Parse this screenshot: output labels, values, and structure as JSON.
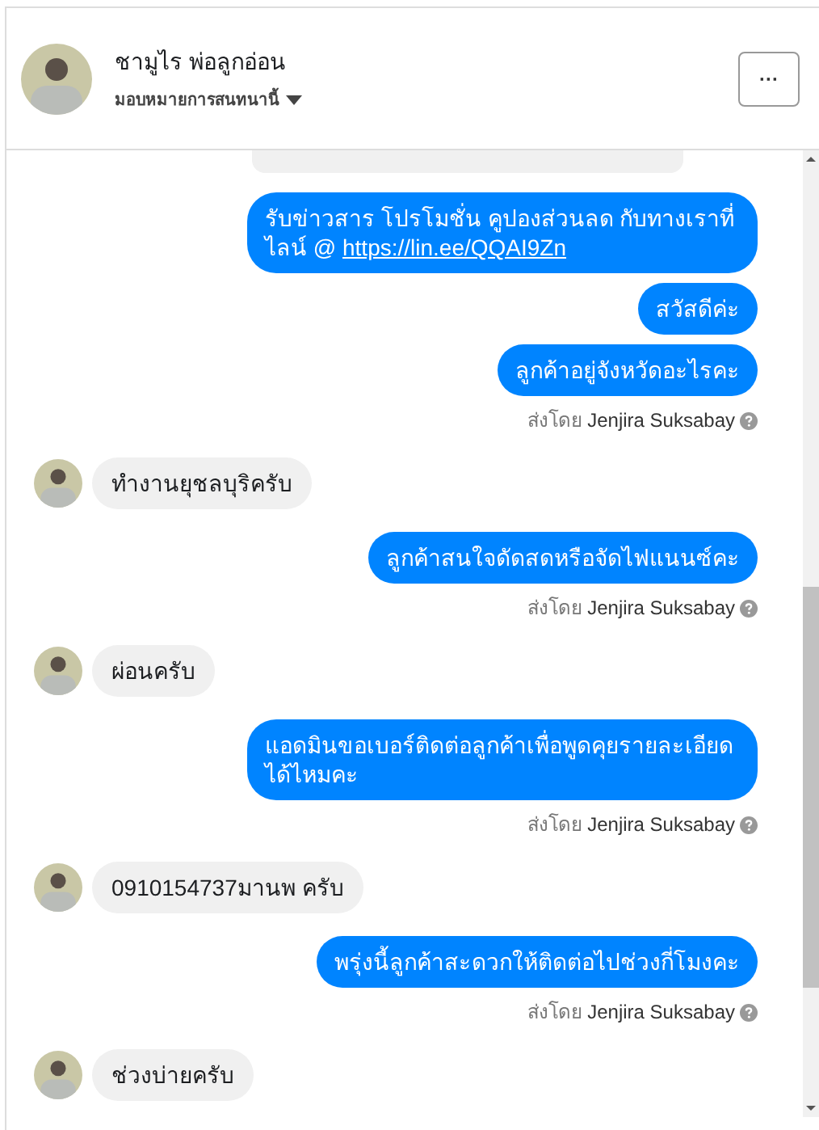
{
  "header": {
    "name": "ชามูไร พ่อลูกอ่อน",
    "assign_label": "มอบหมายการสนทนานี้",
    "more_button": "···"
  },
  "messages": [
    {
      "kind": "cutoff"
    },
    {
      "kind": "outgoing",
      "text": "รับข่าวสาร  โปรโมชั่น คูปองส่วนลด กับทางเราที่ ไลน์ @ ",
      "link": "https://lin.ee/QQAI9Zn"
    },
    {
      "kind": "outgoing",
      "text": "สวัสดีค่ะ"
    },
    {
      "kind": "outgoing",
      "text": "ลูกค้าอยู่จังหวัดอะไรคะ"
    },
    {
      "kind": "sent_by",
      "prefix": "ส่งโดย",
      "sender": "Jenjira Suksabay"
    },
    {
      "kind": "incoming",
      "text": "ทำงานยุชลบุริครับ"
    },
    {
      "kind": "outgoing",
      "text": "ลูกค้าสนใจดัดสดหรือจัดไฟแนนซ์คะ"
    },
    {
      "kind": "sent_by",
      "prefix": "ส่งโดย",
      "sender": "Jenjira Suksabay"
    },
    {
      "kind": "incoming",
      "text": "ผ่อนครับ"
    },
    {
      "kind": "outgoing",
      "text": "แอดมินขอเบอร์ติดต่อลูกค้าเพื่อพูดคุยรายละเอียดได้ไหมคะ"
    },
    {
      "kind": "sent_by",
      "prefix": "ส่งโดย",
      "sender": "Jenjira Suksabay"
    },
    {
      "kind": "incoming",
      "text": "0910154737มานพ ครับ"
    },
    {
      "kind": "outgoing",
      "text": "พรุ่งนี้ลูกค้าสะดวกให้ติดต่อไปช่วงกี่โมงคะ"
    },
    {
      "kind": "sent_by",
      "prefix": "ส่งโดย",
      "sender": "Jenjira Suksabay"
    },
    {
      "kind": "incoming",
      "text": "ช่วงบ่ายครับ"
    }
  ]
}
